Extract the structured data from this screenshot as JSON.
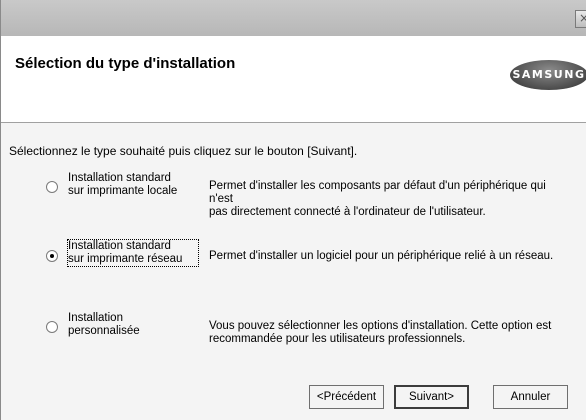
{
  "window": {
    "close_glyph": "×"
  },
  "header": {
    "title": "Sélection du type d'installation",
    "logo_text": "SAMSUNG"
  },
  "instruction": "Sélectionnez le type souhaité puis cliquez sur le bouton [Suivant].",
  "options": [
    {
      "label": "Installation standard\nsur imprimante locale",
      "description": "Permet d'installer les composants par défaut d'un périphérique qui n'est\npas directement connecté à l'ordinateur de l'utilisateur.",
      "selected": false
    },
    {
      "label": "Installation standard\nsur imprimante réseau",
      "description": "Permet d'installer un logiciel pour un périphérique relié à un réseau.",
      "selected": true
    },
    {
      "label": "Installation\npersonnalisée",
      "description": "Vous pouvez sélectionner les options d'installation. Cette option est\nrecommandée pour les utilisateurs professionnels.",
      "selected": false
    }
  ],
  "buttons": {
    "previous": "<Précédent",
    "next": "Suivant>",
    "cancel": "Annuler"
  }
}
